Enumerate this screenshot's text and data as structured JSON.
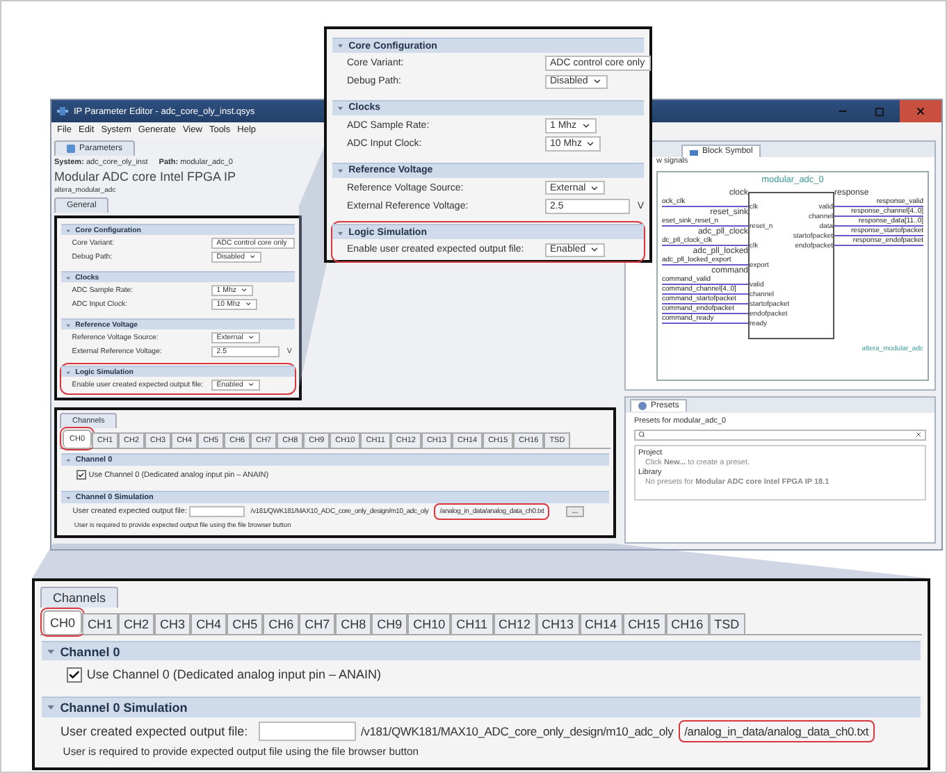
{
  "window": {
    "title": "IP Parameter Editor - adc_core_oly_inst.qsys",
    "menu": [
      "File",
      "Edit",
      "System",
      "Generate",
      "View",
      "Tools",
      "Help"
    ]
  },
  "parameters_panel": {
    "tab": "Parameters",
    "system_label": "System:",
    "system": "adc_core_oly_inst",
    "path_label": "Path:",
    "path": "modular_adc_0",
    "component_title": "Modular ADC core Intel FPGA IP",
    "component_id": "altera_modular_adc",
    "page_tab": "General",
    "sections": [
      {
        "title": "Core Configuration",
        "highlighted": false,
        "rows": [
          {
            "label": "Core Variant:",
            "kind": "text",
            "value": "ADC control core only"
          },
          {
            "label": "Debug Path:",
            "kind": "dropdown",
            "value": "Disabled"
          }
        ]
      },
      {
        "title": "Clocks",
        "highlighted": false,
        "rows": [
          {
            "label": "ADC Sample Rate:",
            "kind": "dropdown",
            "value": "1 Mhz"
          },
          {
            "label": "ADC Input Clock:",
            "kind": "dropdown",
            "value": "10 Mhz"
          }
        ]
      },
      {
        "title": "Reference Voltage",
        "highlighted": false,
        "rows": [
          {
            "label": "Reference Voltage Source:",
            "kind": "dropdown",
            "value": "External"
          },
          {
            "label": "External Reference Voltage:",
            "kind": "field",
            "value": "2.5",
            "unit": "V"
          }
        ]
      },
      {
        "title": "Logic Simulation",
        "highlighted": true,
        "rows": [
          {
            "label": "Enable user created expected output file:",
            "kind": "dropdown",
            "value": "Enabled"
          }
        ]
      }
    ],
    "channels": {
      "tab": "Channels",
      "channel_tabs": [
        {
          "label": "CH0",
          "selected": true,
          "highlighted": true
        },
        {
          "label": "CH1",
          "selected": false,
          "highlighted": false
        },
        {
          "label": "CH2",
          "selected": false,
          "highlighted": false
        },
        {
          "label": "CH3",
          "selected": false,
          "highlighted": false
        },
        {
          "label": "CH4",
          "selected": false,
          "highlighted": false
        },
        {
          "label": "CH5",
          "selected": false,
          "highlighted": false
        },
        {
          "label": "CH6",
          "selected": false,
          "highlighted": false
        },
        {
          "label": "CH7",
          "selected": false,
          "highlighted": false
        },
        {
          "label": "CH8",
          "selected": false,
          "highlighted": false
        },
        {
          "label": "CH9",
          "selected": false,
          "highlighted": false
        },
        {
          "label": "CH10",
          "selected": false,
          "highlighted": false
        },
        {
          "label": "CH11",
          "selected": false,
          "highlighted": false
        },
        {
          "label": "CH12",
          "selected": false,
          "highlighted": false
        },
        {
          "label": "CH13",
          "selected": false,
          "highlighted": false
        },
        {
          "label": "CH14",
          "selected": false,
          "highlighted": false
        },
        {
          "label": "CH15",
          "selected": false,
          "highlighted": false
        },
        {
          "label": "CH16",
          "selected": false,
          "highlighted": false
        },
        {
          "label": "TSD",
          "selected": false,
          "highlighted": false
        }
      ],
      "channel_section": {
        "title": "Channel 0",
        "checkbox": {
          "label": "Use Channel 0 (Dedicated analog input pin – ANAIN)",
          "checked": true
        }
      },
      "simulation_section": {
        "title": "Channel 0 Simulation",
        "label": "User created expected output file:",
        "path": "/v181/QWK181/MAX10_ADC_core_only_design/m10_adc_oly",
        "path_end": "/analog_in_data/analog_data_ch0.txt",
        "path_end_highlighted": true,
        "browse": "...",
        "note": "User is required to provide expected output file using the file browser button"
      }
    }
  },
  "block_symbol_panel": {
    "tab": "Block Symbol",
    "show_signals": "w signals",
    "title": "modular_adc_0",
    "footer": "altera_modular_adc",
    "left": [
      {
        "interface": "clock",
        "signals": [
          {
            "external": "ock_clk",
            "port": "clk"
          }
        ]
      },
      {
        "interface": "reset_sink",
        "signals": [
          {
            "external": "eset_sink_reset_n",
            "port": "reset_n"
          }
        ]
      },
      {
        "interface": "adc_pll_clock",
        "signals": [
          {
            "external": "dc_pll_clock_clk",
            "port": "clk"
          }
        ]
      },
      {
        "interface": "adc_pll_locked",
        "signals": [
          {
            "external": "adc_pll_locked_export",
            "port": "export"
          }
        ]
      },
      {
        "interface": "command",
        "signals": [
          {
            "external": "command_valid",
            "port": "valid"
          },
          {
            "external": "command_channel[4..0]",
            "port": "channel"
          },
          {
            "external": "command_startofpacket",
            "port": "startofpacket"
          },
          {
            "external": "command_endofpacket",
            "port": "endofpacket"
          },
          {
            "external": "command_ready",
            "port": "ready"
          }
        ]
      }
    ],
    "right": [
      {
        "interface": "response",
        "signals": [
          {
            "external": "response_valid",
            "port": "valid"
          },
          {
            "external": "response_channel[4..0]",
            "port": "channel"
          },
          {
            "external": "response_data[11..0]",
            "port": "data"
          },
          {
            "external": "response_startofpacket",
            "port": "startofpacket"
          },
          {
            "external": "response_endofpacket",
            "port": "endofpacket"
          }
        ]
      }
    ]
  },
  "presets_panel": {
    "tab": "Presets",
    "heading": "Presets for modular_adc_0",
    "tree": [
      {
        "label": "Project",
        "children": [
          {
            "label": "Click **New...** to create a preset."
          }
        ]
      },
      {
        "label": "Library",
        "children": [
          {
            "label": "No presets for **Modular ADC core Intel FPGA IP 18.1**"
          }
        ]
      }
    ]
  },
  "callout_top": {
    "sections": [
      {
        "title": "Core Configuration",
        "highlighted": false,
        "rows": [
          {
            "label": "Core Variant:",
            "kind": "text",
            "value": "ADC control core only"
          },
          {
            "label": "Debug Path:",
            "kind": "dropdown",
            "value": "Disabled"
          }
        ]
      },
      {
        "title": "Clocks",
        "highlighted": false,
        "rows": [
          {
            "label": "ADC Sample Rate:",
            "kind": "dropdown",
            "value": "1 Mhz"
          },
          {
            "label": "ADC Input Clock:",
            "kind": "dropdown",
            "value": "10 Mhz"
          }
        ]
      },
      {
        "title": "Reference Voltage",
        "highlighted": false,
        "rows": [
          {
            "label": "Reference Voltage Source:",
            "kind": "dropdown",
            "value": "External"
          },
          {
            "label": "External Reference Voltage:",
            "kind": "field",
            "value": "2.5",
            "unit": "V"
          }
        ]
      },
      {
        "title": "Logic Simulation",
        "highlighted": true,
        "rows": [
          {
            "label": "Enable user created expected output file:",
            "kind": "dropdown",
            "value": "Enabled"
          }
        ]
      }
    ]
  },
  "callout_bottom": {
    "tab": "Channels",
    "channel_tabs": [
      {
        "label": "CH0",
        "selected": true,
        "highlighted": true
      },
      {
        "label": "CH1",
        "selected": false,
        "highlighted": false
      },
      {
        "label": "CH2",
        "selected": false,
        "highlighted": false
      },
      {
        "label": "CH3",
        "selected": false,
        "highlighted": false
      },
      {
        "label": "CH4",
        "selected": false,
        "highlighted": false
      },
      {
        "label": "CH5",
        "selected": false,
        "highlighted": false
      },
      {
        "label": "CH6",
        "selected": false,
        "highlighted": false
      },
      {
        "label": "CH7",
        "selected": false,
        "highlighted": false
      },
      {
        "label": "CH8",
        "selected": false,
        "highlighted": false
      },
      {
        "label": "CH9",
        "selected": false,
        "highlighted": false
      },
      {
        "label": "CH10",
        "selected": false,
        "highlighted": false
      },
      {
        "label": "CH11",
        "selected": false,
        "highlighted": false
      },
      {
        "label": "CH12",
        "selected": false,
        "highlighted": false
      },
      {
        "label": "CH13",
        "selected": false,
        "highlighted": false
      },
      {
        "label": "CH14",
        "selected": false,
        "highlighted": false
      },
      {
        "label": "CH15",
        "selected": false,
        "highlighted": false
      },
      {
        "label": "CH16",
        "selected": false,
        "highlighted": false
      },
      {
        "label": "TSD",
        "selected": false,
        "highlighted": false
      }
    ],
    "channel_section": {
      "title": "Channel 0",
      "checkbox": {
        "label": "Use Channel 0 (Dedicated analog input pin – ANAIN)",
        "checked": true
      }
    },
    "simulation_section": {
      "title": "Channel 0 Simulation",
      "label": "User created expected output file:",
      "path": "/v181/QWK181/MAX10_ADC_core_only_design/m10_adc_oly",
      "path_end": "/analog_in_data/analog_data_ch0.txt",
      "path_end_highlighted": true,
      "note": "User is required to provide expected output file using the file browser button"
    }
  }
}
